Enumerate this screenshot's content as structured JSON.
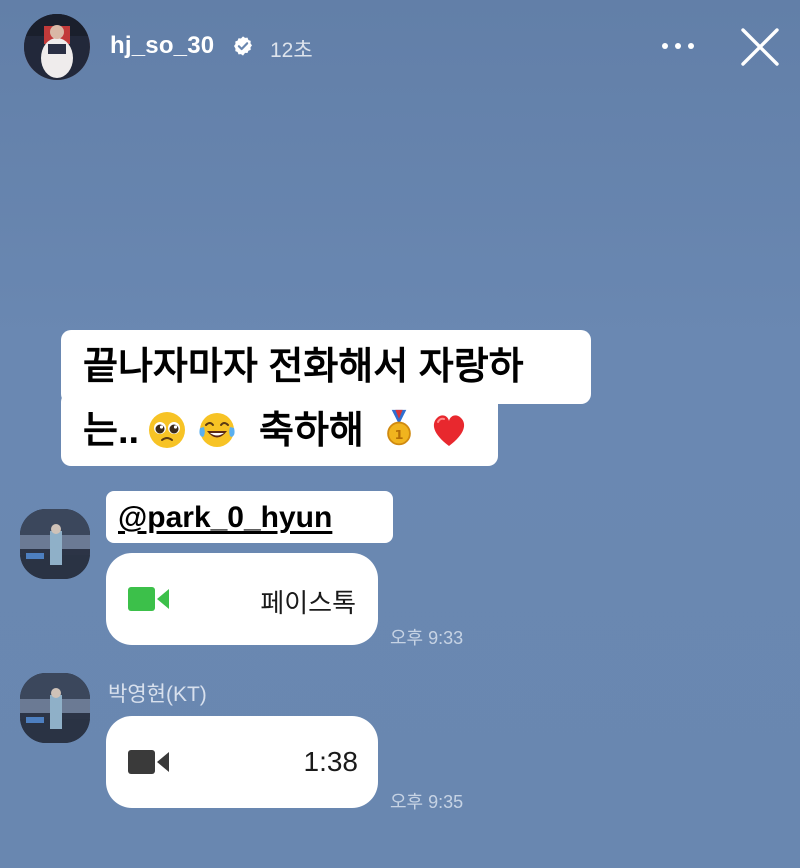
{
  "story": {
    "username": "hj_so_30",
    "time_ago": "12초",
    "verified": true
  },
  "icons": {
    "verified": "verified-badge-icon",
    "more": "more-dots-icon",
    "close": "close-icon",
    "facetime": "video-camera-icon",
    "video_call": "video-camera-icon"
  },
  "caption": {
    "line1": "끝나자마자 전화해서 자랑하",
    "line2_prefix": "는..",
    "line2_suffix": "축하해",
    "emojis": [
      "pleading-face",
      "tears-of-joy",
      "first-place-medal",
      "red-heart"
    ]
  },
  "mention": {
    "handle": "@park_0_hyun"
  },
  "chat": {
    "messages": [
      {
        "label": "페이스톡",
        "time": "오후 9:33",
        "icon_color": "#3cc04a"
      },
      {
        "sender": "박영현(KT)",
        "duration": "1:38",
        "time": "오후 9:35",
        "icon_color": "#3a3a3a"
      }
    ]
  },
  "colors": {
    "background": "#6a87b0",
    "bubble": "#ffffff",
    "facetime_green": "#3cc04a"
  }
}
